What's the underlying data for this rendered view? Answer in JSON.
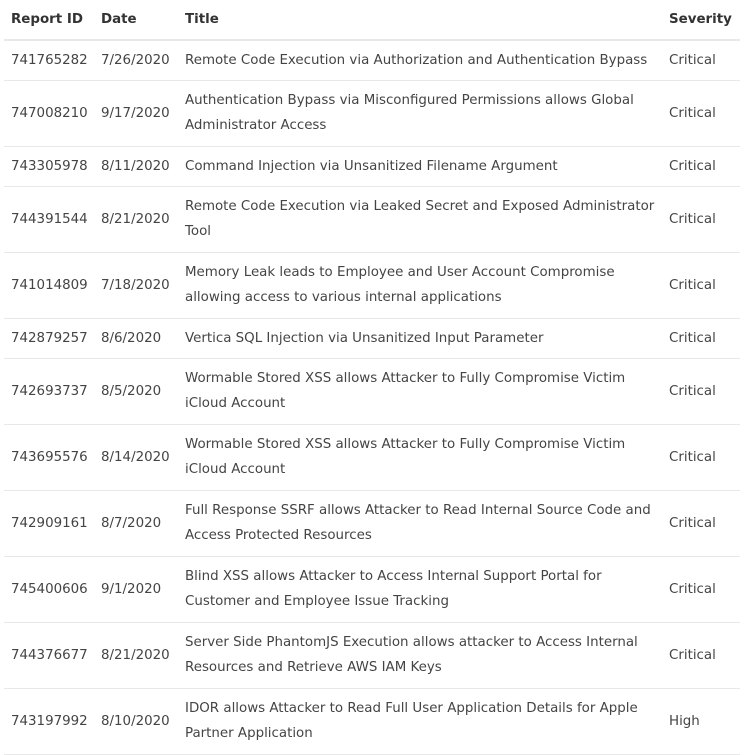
{
  "table": {
    "headers": {
      "report_id": "Report ID",
      "date": "Date",
      "title": "Title",
      "severity": "Severity"
    },
    "rows": [
      {
        "report_id": "741765282",
        "date": "7/26/2020",
        "title": "Remote Code Execution via Authorization and Authentication Bypass",
        "severity": "Critical"
      },
      {
        "report_id": "747008210",
        "date": "9/17/2020",
        "title": "Authentication Bypass via Misconfigured Permissions allows Global Administrator Access",
        "severity": "Critical"
      },
      {
        "report_id": "743305978",
        "date": "8/11/2020",
        "title": "Command Injection via Unsanitized Filename Argument",
        "severity": "Critical"
      },
      {
        "report_id": "744391544",
        "date": "8/21/2020",
        "title": "Remote Code Execution via Leaked Secret and Exposed Administrator Tool",
        "severity": "Critical"
      },
      {
        "report_id": "741014809",
        "date": "7/18/2020",
        "title": "Memory Leak leads to Employee and User Account Compromise allowing access to various internal applications",
        "severity": "Critical"
      },
      {
        "report_id": "742879257",
        "date": "8/6/2020",
        "title": "Vertica SQL Injection via Unsanitized Input Parameter",
        "severity": "Critical"
      },
      {
        "report_id": "742693737",
        "date": "8/5/2020",
        "title": "Wormable Stored XSS allows Attacker to Fully Compromise Victim iCloud Account",
        "severity": "Critical"
      },
      {
        "report_id": "743695576",
        "date": "8/14/2020",
        "title": "Wormable Stored XSS allows Attacker to Fully Compromise Victim iCloud Account",
        "severity": "Critical"
      },
      {
        "report_id": "742909161",
        "date": "8/7/2020",
        "title": "Full Response SSRF allows Attacker to Read Internal Source Code and Access Protected Resources",
        "severity": "Critical"
      },
      {
        "report_id": "745400606",
        "date": "9/1/2020",
        "title": "Blind XSS allows Attacker to Access Internal Support Portal for Customer and Employee Issue Tracking",
        "severity": "Critical"
      },
      {
        "report_id": "744376677",
        "date": "8/21/2020",
        "title": "Server Side PhantomJS Execution allows attacker to Access Internal Resources and Retrieve AWS IAM Keys",
        "severity": "Critical"
      },
      {
        "report_id": "743197992",
        "date": "8/10/2020",
        "title": "IDOR allows Attacker to Read Full User Application Details for Apple Partner Application",
        "severity": "High"
      }
    ]
  }
}
